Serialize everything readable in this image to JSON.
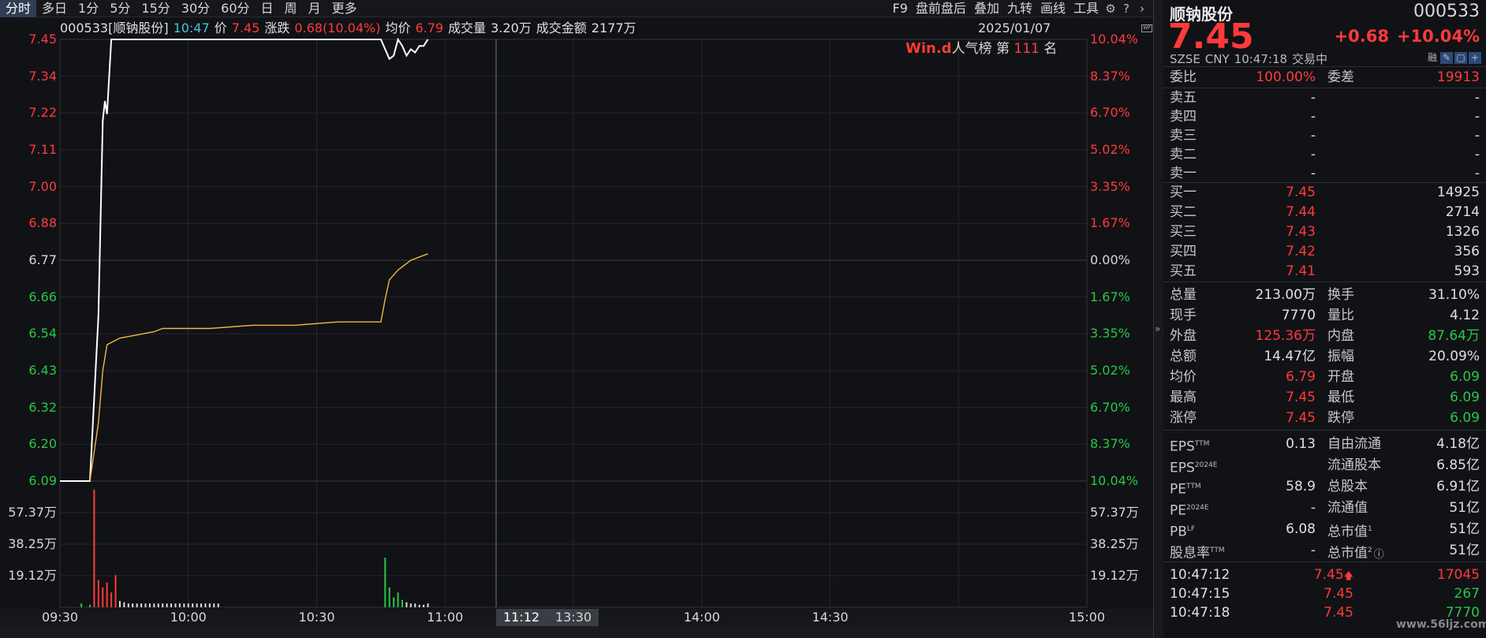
{
  "toolbar": {
    "tabs": [
      "分时",
      "多日",
      "1分",
      "5分",
      "15分",
      "30分",
      "60分",
      "日",
      "周",
      "月",
      "更多"
    ],
    "buttons": [
      "F9",
      "盘前盘后",
      "叠加",
      "九转",
      "画线",
      "工具"
    ]
  },
  "info": {
    "code_name": "000533[顺钠股份]",
    "time": "10:47",
    "price_label": "价",
    "price": "7.45",
    "chg_label": "涨跌",
    "chg": "0.68(10.04%)",
    "avg_label": "均价",
    "avg": "6.79",
    "vol_label": "成交量",
    "vol": "3.20万",
    "amt_label": "成交金额",
    "amt": "2177万"
  },
  "date": "2025/01/07",
  "rank": {
    "brand": "Win.d",
    "label": "人气榜",
    "pre": "第",
    "num": "111",
    "post": "名"
  },
  "colors": {
    "up": "#ff3a3a",
    "down": "#25c944",
    "price_line": "#ffffff",
    "avg_line": "#f0b840"
  },
  "chart_data": {
    "type": "line",
    "x_ticks": [
      "09:30",
      "10:00",
      "10:30",
      "11:00",
      "11:12",
      "13:30",
      "14:00",
      "14:30",
      "15:00"
    ],
    "price_axis": [
      "7.45",
      "7.34",
      "7.22",
      "7.11",
      "7.00",
      "6.88",
      "6.77",
      "6.66",
      "6.54",
      "6.43",
      "6.32",
      "6.20",
      "6.09"
    ],
    "pct_axis": [
      "10.04%",
      "8.37%",
      "6.70%",
      "5.02%",
      "3.35%",
      "1.67%",
      "0.00%",
      "1.67%",
      "3.35%",
      "5.02%",
      "6.70%",
      "8.37%",
      "10.04%"
    ],
    "vol_axis": [
      "57.37万",
      "38.25万",
      "19.12万"
    ],
    "ylim": [
      6.09,
      7.45
    ],
    "series": [
      {
        "values": [
          [
            0,
            6.09
          ],
          [
            7,
            6.09
          ],
          [
            9,
            6.6
          ],
          [
            10,
            7.2
          ],
          [
            10.5,
            7.26
          ],
          [
            11,
            7.22
          ],
          [
            12,
            7.45
          ],
          [
            75,
            7.45
          ],
          [
            76,
            7.42
          ],
          [
            77,
            7.39
          ],
          [
            78,
            7.4
          ],
          [
            79,
            7.45
          ],
          [
            80,
            7.43
          ],
          [
            81,
            7.4
          ],
          [
            82,
            7.42
          ],
          [
            83,
            7.41
          ],
          [
            84,
            7.43
          ],
          [
            85,
            7.43
          ],
          [
            86,
            7.45
          ]
        ]
      },
      {
        "values": [
          [
            7,
            6.09
          ],
          [
            9,
            6.27
          ],
          [
            10,
            6.43
          ],
          [
            11,
            6.51
          ],
          [
            14,
            6.53
          ],
          [
            18,
            6.54
          ],
          [
            22,
            6.55
          ],
          [
            24,
            6.56
          ],
          [
            28,
            6.56
          ],
          [
            35,
            6.56
          ],
          [
            45,
            6.57
          ],
          [
            55,
            6.57
          ],
          [
            65,
            6.58
          ],
          [
            75,
            6.58
          ],
          [
            76,
            6.65
          ],
          [
            77,
            6.71
          ],
          [
            79,
            6.74
          ],
          [
            82,
            6.77
          ],
          [
            86,
            6.79
          ]
        ]
      }
    ],
    "volume_bars": [
      [
        5,
        3
      ],
      [
        7,
        2
      ],
      [
        8,
        95
      ],
      [
        9,
        22
      ],
      [
        10,
        16
      ],
      [
        11,
        20
      ],
      [
        12,
        12
      ],
      [
        13,
        26
      ],
      [
        14,
        5
      ],
      [
        15,
        4
      ],
      [
        16,
        3
      ],
      [
        17,
        3
      ],
      [
        18,
        3
      ],
      [
        19,
        3
      ],
      [
        20,
        3
      ],
      [
        21,
        3
      ],
      [
        22,
        3
      ],
      [
        23,
        3
      ],
      [
        24,
        3
      ],
      [
        25,
        3
      ],
      [
        26,
        3
      ],
      [
        27,
        3
      ],
      [
        28,
        3
      ],
      [
        29,
        3
      ],
      [
        30,
        3
      ],
      [
        31,
        3
      ],
      [
        32,
        3
      ],
      [
        33,
        3
      ],
      [
        34,
        3
      ],
      [
        35,
        3
      ],
      [
        36,
        3
      ],
      [
        37,
        3
      ],
      [
        76,
        40
      ],
      [
        77,
        16
      ],
      [
        78,
        8
      ],
      [
        79,
        12
      ],
      [
        80,
        6
      ],
      [
        81,
        4
      ],
      [
        82,
        3
      ],
      [
        83,
        3
      ],
      [
        84,
        2
      ],
      [
        85,
        2
      ],
      [
        86,
        3
      ]
    ]
  },
  "panel": {
    "name": "顺钠股份",
    "code": "000533",
    "price": "7.45",
    "chg": "+0.68",
    "pct": "+10.04%",
    "sub": [
      "SZSE",
      "CNY",
      "10:47:18",
      "交易中"
    ],
    "mini_icons": [
      "融",
      "✎",
      "▢",
      "+"
    ],
    "weibi": {
      "l1": "委比",
      "v1": "100.00%",
      "l2": "委差",
      "v2": "19913"
    },
    "asks": [
      {
        "label": "卖五",
        "price": "-",
        "vol": "-"
      },
      {
        "label": "卖四",
        "price": "-",
        "vol": "-"
      },
      {
        "label": "卖三",
        "price": "-",
        "vol": "-"
      },
      {
        "label": "卖二",
        "price": "-",
        "vol": "-"
      },
      {
        "label": "卖一",
        "price": "-",
        "vol": "-"
      }
    ],
    "bids": [
      {
        "label": "买一",
        "price": "7.45",
        "vol": "14925"
      },
      {
        "label": "买二",
        "price": "7.44",
        "vol": "2714"
      },
      {
        "label": "买三",
        "price": "7.43",
        "vol": "1326"
      },
      {
        "label": "买四",
        "price": "7.42",
        "vol": "356"
      },
      {
        "label": "买五",
        "price": "7.41",
        "vol": "593"
      }
    ],
    "stats": [
      [
        "总量",
        "213.00万",
        "w",
        "换手",
        "31.10%",
        "w"
      ],
      [
        "现手",
        "7770",
        "w",
        "量比",
        "4.12",
        "w"
      ],
      [
        "外盘",
        "125.36万",
        "r",
        "内盘",
        "87.64万",
        "g"
      ],
      [
        "总额",
        "14.47亿",
        "w",
        "振幅",
        "20.09%",
        "w"
      ],
      [
        "均价",
        "6.79",
        "r",
        "开盘",
        "6.09",
        "g"
      ],
      [
        "最高",
        "7.45",
        "r",
        "最低",
        "6.09",
        "g"
      ],
      [
        "涨停",
        "7.45",
        "r",
        "跌停",
        "6.09",
        "g"
      ]
    ],
    "fund": [
      [
        "EPS",
        "TTM",
        "0.13",
        "自由流通",
        "",
        "4.18亿"
      ],
      [
        "EPS",
        "2024E",
        "",
        "流通股本",
        "",
        "6.85亿"
      ],
      [
        "PE",
        "TTM",
        "58.9",
        "总股本",
        "",
        "6.91亿"
      ],
      [
        "PE",
        "2024E",
        "-",
        "流通值",
        "",
        "51亿"
      ],
      [
        "PB",
        "LF",
        "6.08",
        "总市值",
        "1",
        "51亿"
      ],
      [
        "股息率",
        "TTM",
        "-",
        "总市值",
        "2",
        "51亿"
      ]
    ],
    "ticks": [
      {
        "time": "10:47:12",
        "price": "7.45",
        "arrow": "🡅",
        "vol": "17045",
        "vc": "r"
      },
      {
        "time": "10:47:15",
        "price": "7.45",
        "arrow": "",
        "vol": "267",
        "vc": "g"
      },
      {
        "time": "10:47:18",
        "price": "7.45",
        "arrow": "",
        "vol": "7770",
        "vc": "g"
      }
    ]
  },
  "watermark": "www.56ljz.com"
}
